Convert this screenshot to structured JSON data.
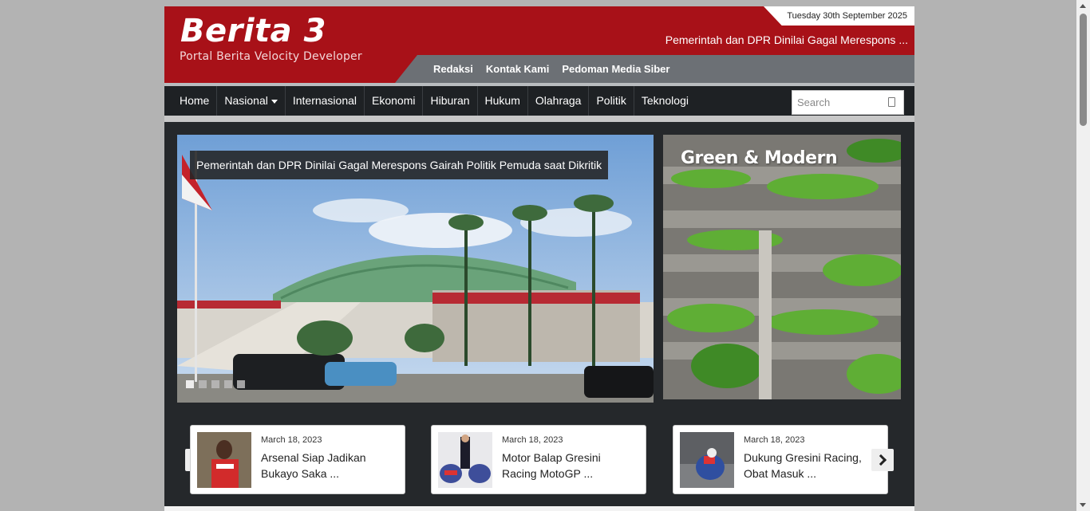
{
  "site": {
    "title": "Berita 3",
    "tagline": "Portal Berita Velocity Developer",
    "date": "Tuesday 30th September 2025",
    "ticker": "Pemerintah dan DPR Dinilai Gagal Merespons ..."
  },
  "top_links": [
    "Redaksi",
    "Kontak Kami",
    "Pedoman Media Siber"
  ],
  "nav": {
    "items": [
      "Home",
      "Nasional",
      "Internasional",
      "Ekonomi",
      "Hiburan",
      "Hukum",
      "Olahraga",
      "Politik",
      "Teknologi"
    ],
    "search_placeholder": "Search"
  },
  "slider": {
    "caption": "Pemerintah dan DPR Dinilai Gagal Merespons Gairah Politik Pemuda saat Dikritik",
    "dot_count": 5,
    "active_dot": 1
  },
  "banner": {
    "title": "Green & Modern"
  },
  "cards": [
    {
      "date": "March 18, 2023",
      "title": "Arsenal Siap Jadikan Bukayo Saka ..."
    },
    {
      "date": "March 18, 2023",
      "title": "Motor Balap Gresini Racing MotoGP ..."
    },
    {
      "date": "March 18, 2023",
      "title": "Dukung Gresini Racing, Obat Masuk ..."
    }
  ],
  "colors": {
    "brand_red": "#a81118",
    "nav_dark": "#1e2124",
    "topnav_gray": "#6c7075"
  },
  "icons": {
    "search": "search-icon",
    "prev": "chevron-left-icon",
    "next": "chevron-right-icon"
  }
}
